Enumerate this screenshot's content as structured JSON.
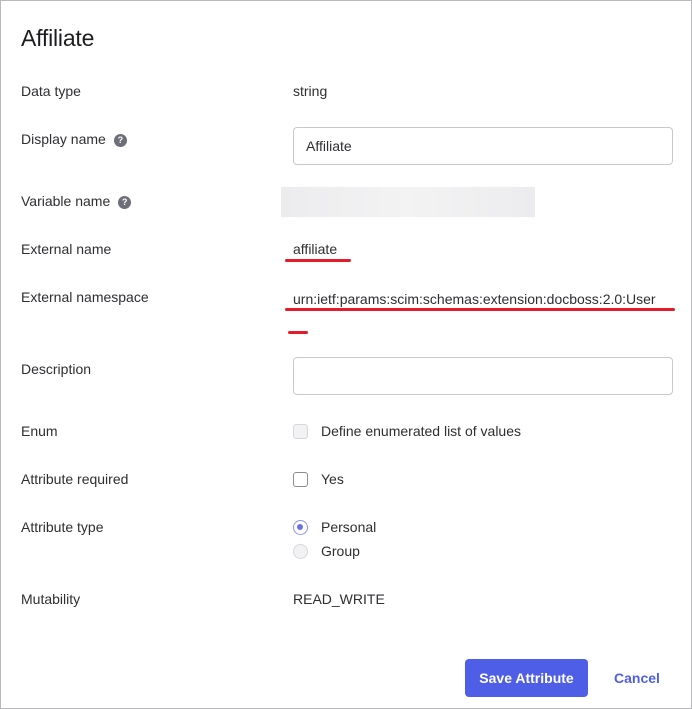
{
  "dialog": {
    "title": "Affiliate"
  },
  "fields": {
    "data_type": {
      "label": "Data type",
      "value": "string"
    },
    "display_name": {
      "label": "Display name",
      "value": "Affiliate",
      "help": "?"
    },
    "variable_name": {
      "label": "Variable name",
      "help": "?"
    },
    "external_name": {
      "label": "External name",
      "value": "affiliate"
    },
    "external_namespace": {
      "label": "External namespace",
      "value": "urn:ietf:params:scim:schemas:extension:docboss:2.0:User"
    },
    "description": {
      "label": "Description",
      "value": ""
    },
    "enum": {
      "label": "Enum",
      "option": "Define enumerated list of values",
      "checked": false
    },
    "attribute_required": {
      "label": "Attribute required",
      "option": "Yes",
      "checked": false
    },
    "attribute_type": {
      "label": "Attribute type",
      "options": [
        "Personal",
        "Group"
      ],
      "selected": "Personal"
    },
    "mutability": {
      "label": "Mutability",
      "value": "READ_WRITE"
    }
  },
  "actions": {
    "save_label": "Save Attribute",
    "cancel_label": "Cancel"
  },
  "colors": {
    "accent": "#4f5ee6",
    "annotation_red": "#e31b2b"
  }
}
